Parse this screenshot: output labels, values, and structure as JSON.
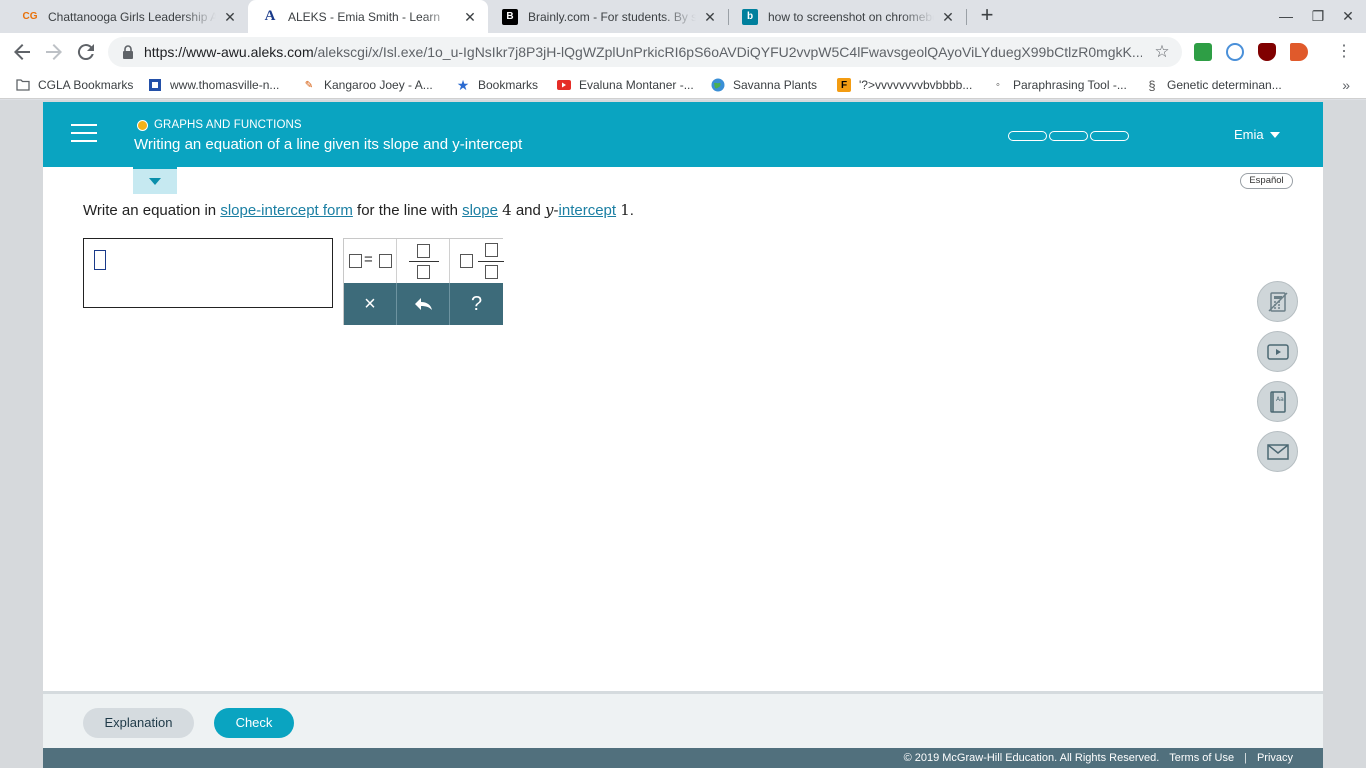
{
  "browser": {
    "tabs": [
      {
        "title": "Chattanooga Girls Leadership Academy",
        "favicon": "CG"
      },
      {
        "title": "ALEKS - Emia Smith - Learn",
        "favicon": "A",
        "active": true
      },
      {
        "title": "Brainly.com - For students. By students",
        "favicon": "B"
      },
      {
        "title": "how to screenshot on chromebook",
        "favicon": "b"
      }
    ],
    "url_host": "https://www-awu.aleks.com",
    "url_path": "/alekscgi/x/Isl.exe/1o_u-IgNsIkr7j8P3jH-lQgWZplUnPrkicRI6pS6oAVDiQYFU2vvpW5C4lFwavsgeolQAyoViLYduegX99bCtlzR0mgkK...",
    "bookmarks": [
      {
        "label": "CGLA Bookmarks",
        "icon": "folder-icon"
      },
      {
        "label": "www.thomasville-n...",
        "icon": "page-icon"
      },
      {
        "label": "Kangaroo Joey - A...",
        "icon": "kangaroo-icon"
      },
      {
        "label": "Bookmarks",
        "icon": "star-icon"
      },
      {
        "label": "Evaluna Montaner -...",
        "icon": "youtube-icon"
      },
      {
        "label": "Savanna Plants",
        "icon": "globe-icon"
      },
      {
        "label": "'?>vvvvvvvvbvbbbb...",
        "icon": "f-icon"
      },
      {
        "label": "Paraphrasing Tool -...",
        "icon": "quote-icon"
      },
      {
        "label": "Genetic determinan...",
        "icon": "dna-icon"
      }
    ],
    "more_bookmarks": "»"
  },
  "header": {
    "category": "GRAPHS AND FUNCTIONS",
    "title": "Writing an equation of a line given its slope and y-intercept",
    "user": "Emia",
    "progress_segments": 3
  },
  "language_button": "Español",
  "question": {
    "prefix": "Write an equation in ",
    "link1": "slope-intercept form",
    "mid1": " for the line with ",
    "link2": "slope",
    "slope_value": "4",
    "mid2": " and ",
    "var_y": "y",
    "dash": "-",
    "link3": "intercept",
    "intercept_value": "1",
    "end": "."
  },
  "keypad": {
    "equals": "=",
    "clear": "×",
    "help": "?"
  },
  "footer": {
    "explanation": "Explanation",
    "check": "Check",
    "copyright": "© 2019 McGraw-Hill Education. All Rights Reserved.",
    "terms": "Terms of Use",
    "divider": "|",
    "privacy": "Privacy"
  },
  "colors": {
    "header": "#0aa4c1",
    "keypad": "#3d6b7a",
    "footer_bar": "#51707d"
  }
}
